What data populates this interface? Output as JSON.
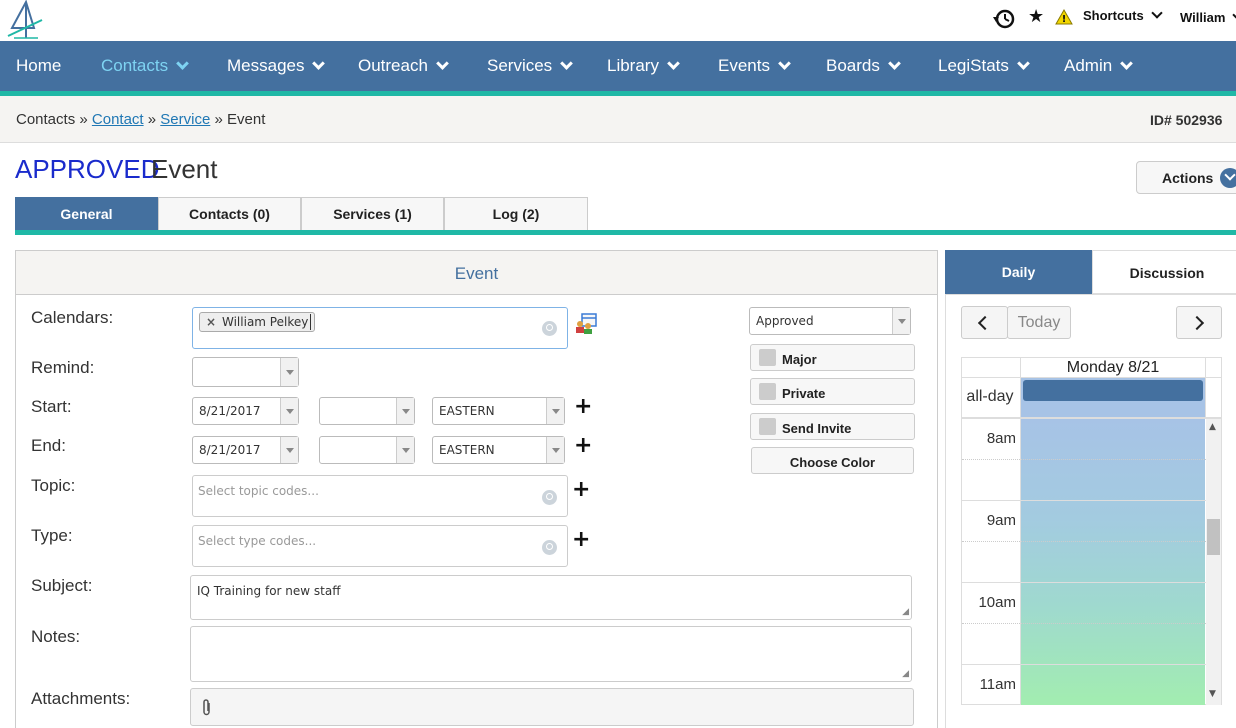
{
  "topbar": {
    "logo_icon": "four-logo-icon",
    "history_icon": "history-icon",
    "star_icon": "star-icon",
    "alert_icon": "alert-icon",
    "shortcuts_label": "Shortcuts",
    "user_label": "William"
  },
  "nav": {
    "items": [
      {
        "label": "Home"
      },
      {
        "label": "Contacts"
      },
      {
        "label": "Messages"
      },
      {
        "label": "Outreach"
      },
      {
        "label": "Services"
      },
      {
        "label": "Library"
      },
      {
        "label": "Events"
      },
      {
        "label": "Boards"
      },
      {
        "label": "LegiStats"
      },
      {
        "label": "Admin"
      }
    ],
    "active": "Contacts"
  },
  "breadcrumb": {
    "root": "Contacts",
    "sep": "»",
    "link1": "Contact",
    "link2": "Service",
    "current": "Event",
    "id_text": "ID# 502936"
  },
  "header": {
    "status": "APPROVED",
    "title": "Event",
    "actions_label": "Actions"
  },
  "tabs": [
    {
      "label": "General",
      "active": true
    },
    {
      "label": "Contacts (0)"
    },
    {
      "label": "Services (1)"
    },
    {
      "label": "Log (2)"
    }
  ],
  "form": {
    "panel_title": "Event",
    "labels": {
      "calendars": "Calendars:",
      "remind": "Remind:",
      "start": "Start:",
      "end": "End:",
      "topic": "Topic:",
      "type": "Type:",
      "subject": "Subject:",
      "notes": "Notes:",
      "attachments": "Attachments:"
    },
    "calendar_tag": "William Pelkey",
    "remind_value": "",
    "start": {
      "date": "8/21/2017",
      "time": "",
      "tz": "EASTERN"
    },
    "end": {
      "date": "8/21/2017",
      "time": "",
      "tz": "EASTERN"
    },
    "topic_placeholder": "Select topic codes...",
    "type_placeholder": "Select type codes...",
    "subject_value": "IQ Training for new staff",
    "notes_value": "",
    "status_select": "Approved",
    "checks": [
      {
        "label": "Major",
        "checked": false
      },
      {
        "label": "Private",
        "checked": false
      },
      {
        "label": "Send Invite",
        "checked": false
      }
    ],
    "choose_color_label": "Choose Color"
  },
  "calendar": {
    "tab_daily": "Daily",
    "tab_discussion": "Discussion",
    "today_label": "Today",
    "day_header": "Monday 8/21",
    "allday_label": "all-day",
    "hours": [
      "8am",
      "9am",
      "10am",
      "11am"
    ],
    "event_color": "#a7c3e6",
    "accent": "#44709f"
  }
}
